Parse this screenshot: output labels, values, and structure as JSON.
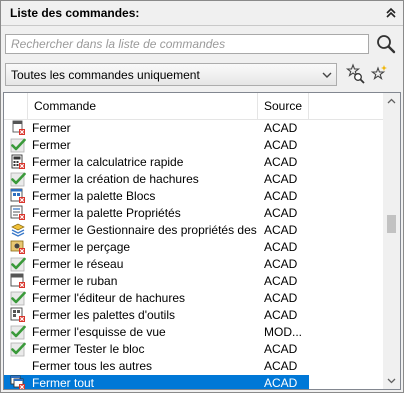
{
  "panel": {
    "title": "Liste des commandes:"
  },
  "search": {
    "placeholder": "Rechercher dans la liste de commandes",
    "value": ""
  },
  "filter": {
    "selected": "Toutes les commandes uniquement"
  },
  "columns": {
    "command": "Commande",
    "source": "Source"
  },
  "rows": [
    {
      "name": "Fermer",
      "source": "ACAD",
      "icon": "close-window-icon"
    },
    {
      "name": "Fermer",
      "source": "ACAD",
      "icon": "checkmark-icon"
    },
    {
      "name": "Fermer la calculatrice rapide",
      "source": "ACAD",
      "icon": "calculator-icon"
    },
    {
      "name": "Fermer la création de hachures",
      "source": "ACAD",
      "icon": "checkmark-icon"
    },
    {
      "name": "Fermer la palette Blocs",
      "source": "ACAD",
      "icon": "blocks-palette-icon"
    },
    {
      "name": "Fermer la palette Propriétés",
      "source": "ACAD",
      "icon": "properties-palette-icon"
    },
    {
      "name": "Fermer le Gestionnaire des propriétés des cal...",
      "source": "ACAD",
      "icon": "layer-manager-icon"
    },
    {
      "name": "Fermer le perçage",
      "source": "ACAD",
      "icon": "drilling-icon"
    },
    {
      "name": "Fermer le réseau",
      "source": "ACAD",
      "icon": "checkmark-icon"
    },
    {
      "name": "Fermer le ruban",
      "source": "ACAD",
      "icon": "ribbon-icon"
    },
    {
      "name": "Fermer l'éditeur de hachures",
      "source": "ACAD",
      "icon": "checkmark-icon"
    },
    {
      "name": "Fermer les palettes d'outils",
      "source": "ACAD",
      "icon": "tool-palettes-icon"
    },
    {
      "name": "Fermer l'esquisse de vue",
      "source": "MOD...",
      "icon": "checkmark-icon"
    },
    {
      "name": "Fermer Tester le bloc",
      "source": "ACAD",
      "icon": "checkmark-icon"
    },
    {
      "name": "Fermer tous les autres",
      "source": "ACAD",
      "icon": ""
    },
    {
      "name": "Fermer tout",
      "source": "ACAD",
      "icon": "close-all-icon",
      "selected": true
    }
  ],
  "colors": {
    "selection": "#0078d7",
    "check_green": "#3a9a3a",
    "close_red": "#d9342b"
  }
}
